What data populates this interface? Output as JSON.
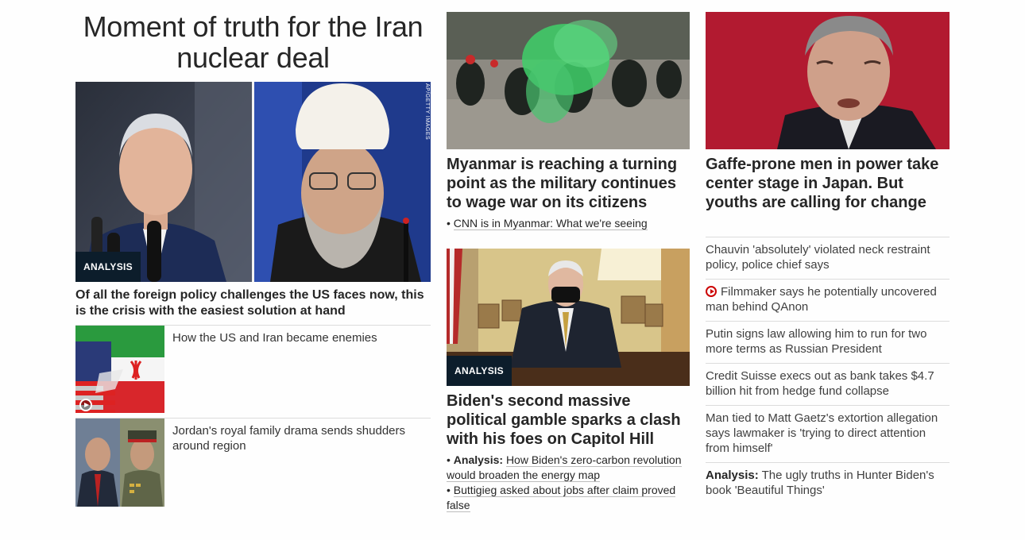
{
  "col1": {
    "banner": "Moment of truth for the Iran nuclear deal",
    "hero": {
      "credit": "AP/GETTY IMAGES",
      "badge": "ANALYSIS",
      "headline": "Of all the foreign policy challenges the US faces now, this is the crisis with the easiest solution at hand"
    },
    "thumbs": [
      {
        "text": "How the US and Iran became enemies",
        "video": true
      },
      {
        "text": "Jordan's royal family drama sends shudders around region",
        "video": false
      }
    ]
  },
  "col2": {
    "card1": {
      "headline": "Myanmar is reaching a turning point as the military continues to wage war on its citizens",
      "links": [
        {
          "bullet": "• ",
          "label": "",
          "text": "CNN is in Myanmar: What we're seeing"
        }
      ]
    },
    "card2": {
      "badge": "ANALYSIS",
      "headline": "Biden's second massive political gamble sparks a clash with his foes on Capitol Hill",
      "links": [
        {
          "bullet": "• ",
          "label": "Analysis:",
          "text": "How Biden's zero-carbon revolution would broaden the energy map"
        },
        {
          "bullet": "• ",
          "label": "",
          "text": "Buttigieg asked about jobs after claim proved false"
        }
      ]
    }
  },
  "col3": {
    "headline": "Gaffe-prone men in power take center stage in Japan. But youths are calling for change",
    "items": [
      {
        "label": "",
        "text": "Chauvin 'absolutely' violated neck restraint policy, police chief says",
        "video": false
      },
      {
        "label": "",
        "text": "Filmmaker says he potentially uncovered man behind QAnon",
        "video": true
      },
      {
        "label": "",
        "text": "Putin signs law allowing him to run for two more terms as Russian President",
        "video": false
      },
      {
        "label": "",
        "text": "Credit Suisse execs out as bank takes $4.7 billion hit from hedge fund collapse",
        "video": false
      },
      {
        "label": "",
        "text": "Man tied to Matt Gaetz's extortion allegation says lawmaker is 'trying to direct attention from himself'",
        "video": false
      },
      {
        "label": "Analysis:",
        "text": "The ugly truths in Hunter Biden's book 'Beautiful Things'",
        "video": false
      }
    ]
  },
  "colors": {
    "badge_bg": "#0c1d2b",
    "video_red": "#cc0000",
    "divider": "#dcdcdc"
  }
}
